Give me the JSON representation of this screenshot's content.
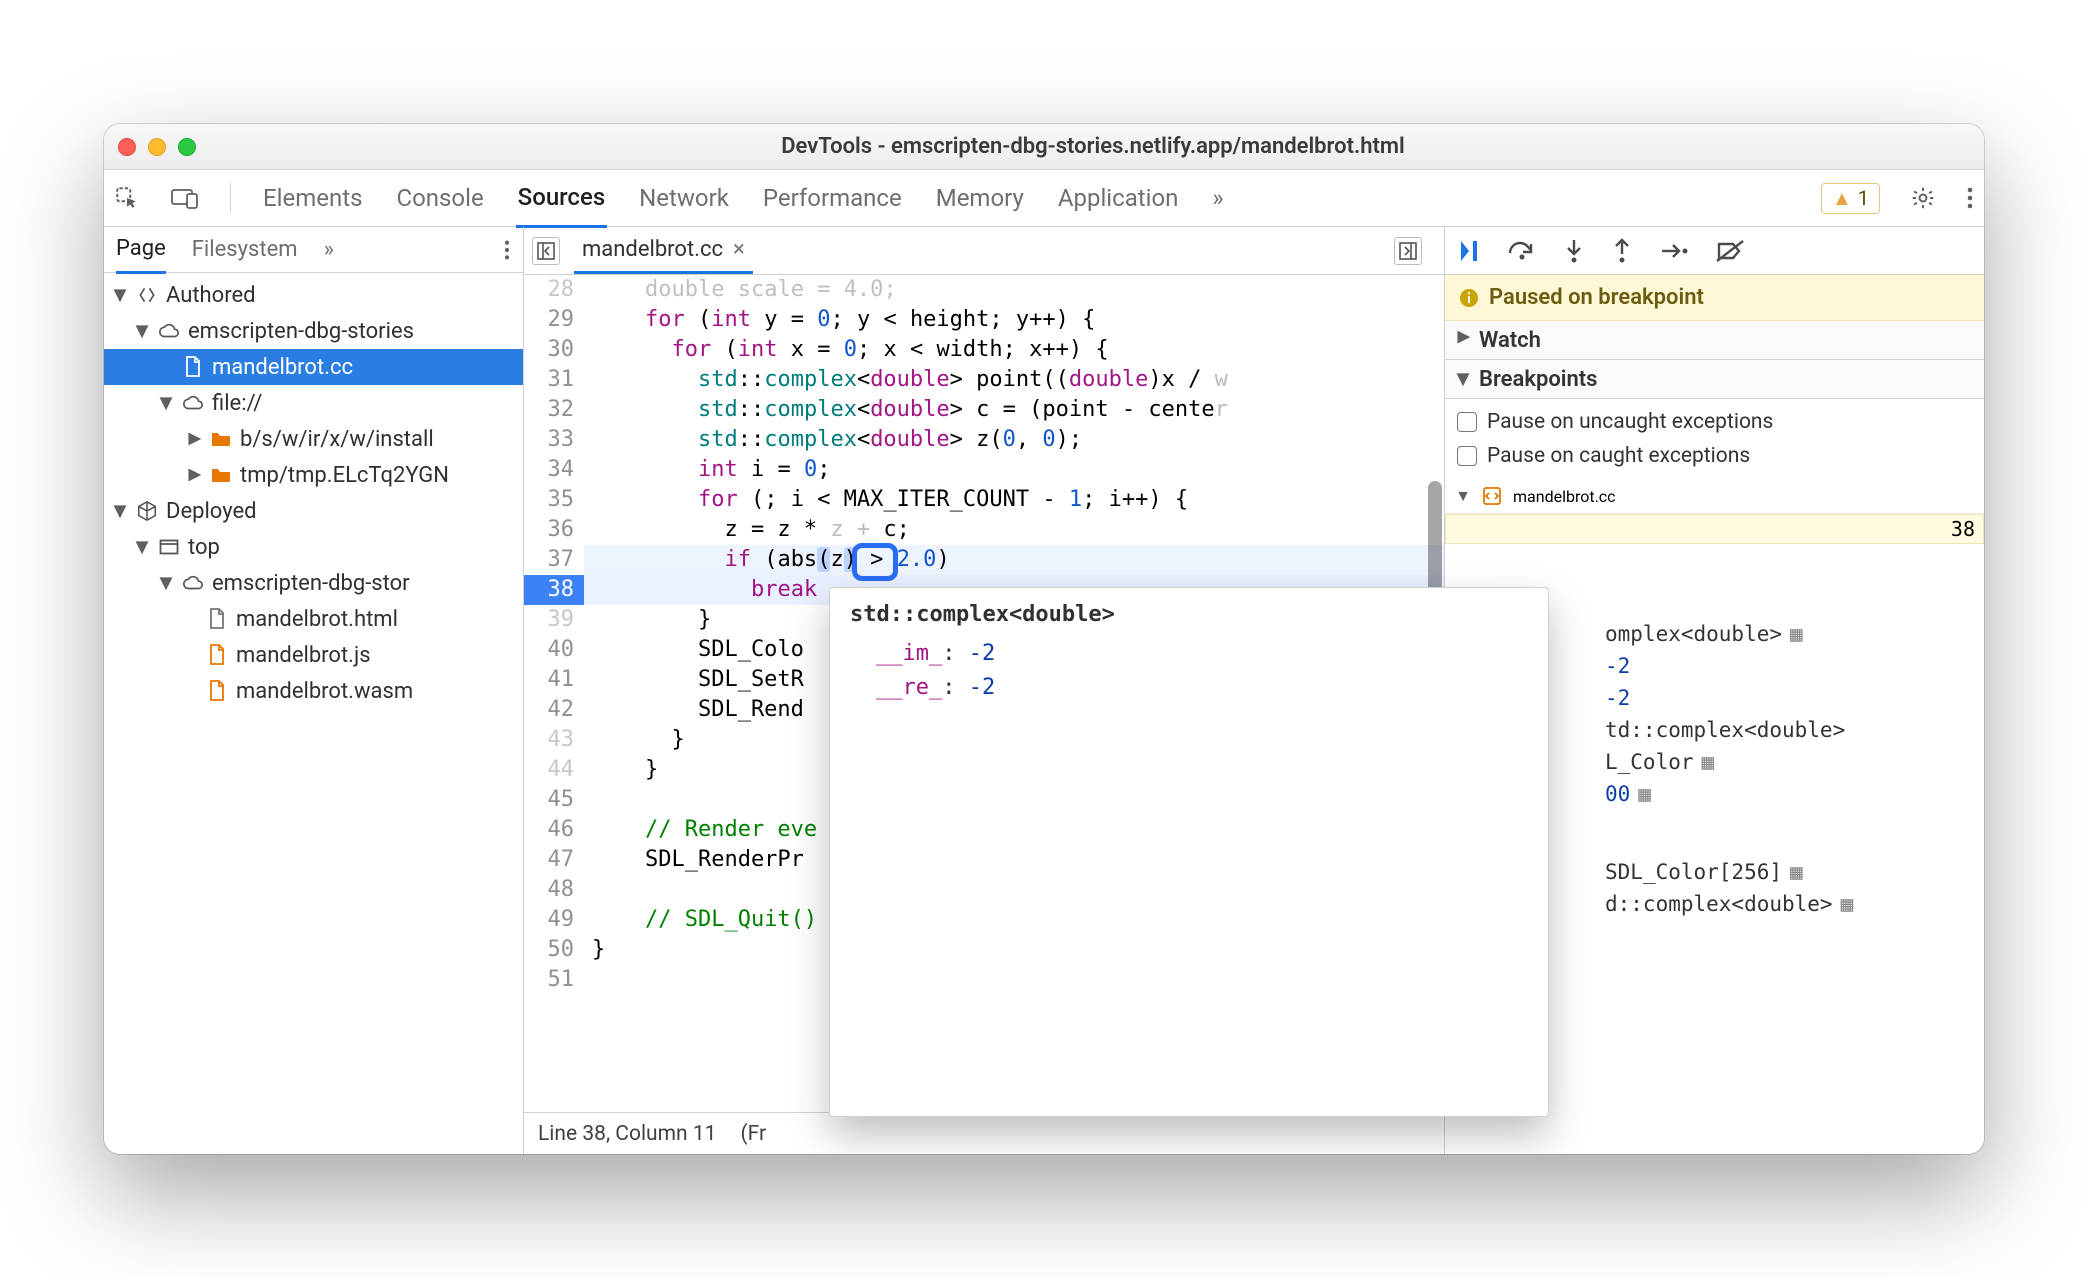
{
  "window": {
    "title": "DevTools - emscripten-dbg-stories.netlify.app/mandelbrot.html"
  },
  "tabs": {
    "items": [
      "Elements",
      "Console",
      "Sources",
      "Network",
      "Performance",
      "Memory",
      "Application"
    ],
    "active": "Sources",
    "more": "»",
    "warn_count": "1"
  },
  "leftTabs": {
    "page": "Page",
    "filesystem": "Filesystem",
    "more": "»"
  },
  "tree": {
    "root1": {
      "label": "Authored"
    },
    "authoredDomain": {
      "label": "emscripten-dbg-stories"
    },
    "selectedFile": {
      "label": "mandelbrot.cc"
    },
    "fileScheme": {
      "label": "file://"
    },
    "folder1": {
      "label": "b/s/w/ir/x/w/install"
    },
    "folder2": {
      "label": "tmp/tmp.ELcTq2YGN"
    },
    "root2": {
      "label": "Deployed"
    },
    "top": {
      "label": "top"
    },
    "deployedDomain": {
      "label": "emscripten-dbg-stor"
    },
    "file_html": {
      "label": "mandelbrot.html"
    },
    "file_js": {
      "label": "mandelbrot.js"
    },
    "file_wasm": {
      "label": "mandelbrot.wasm"
    }
  },
  "file": {
    "name": "mandelbrot.cc"
  },
  "gutter": {
    "start": 28,
    "end": 51,
    "breakpointLine": 38
  },
  "code": {
    "l28": "    double scale = 4.0;",
    "l47": "    SDL_RenderPre",
    "z_char": "z"
  },
  "tooltip": {
    "title": "std::complex<double>",
    "rows": [
      {
        "k": "__im_",
        "v": "-2"
      },
      {
        "k": "__re_",
        "v": "-2"
      }
    ]
  },
  "status": {
    "pos": "Line 38, Column 11",
    "extra": "(Fr"
  },
  "debugger": {
    "paused": "Paused on breakpoint",
    "watch": "Watch",
    "breakpoints": "Breakpoints",
    "pauseUncaught": "Pause on uncaught exceptions",
    "pauseCaught": "Pause on caught exceptions",
    "bpFile": "mandelbrot.cc",
    "bpLine": "38"
  },
  "scope": {
    "rows": [
      {
        "t": "omplex<double>",
        "mem": true
      },
      {
        "t": "-2",
        "val": true
      },
      {
        "t": "-2",
        "val": true
      },
      {
        "t": "td::complex<double>",
        "mem": false
      },
      {
        "t": "L_Color",
        "mem": true
      },
      {
        "t": "00",
        "mem": true
      },
      {
        "spacer": true
      },
      {
        "t": "SDL_Color[256]",
        "mem": true
      },
      {
        "t": "d::complex<double>",
        "mem": true
      }
    ]
  }
}
